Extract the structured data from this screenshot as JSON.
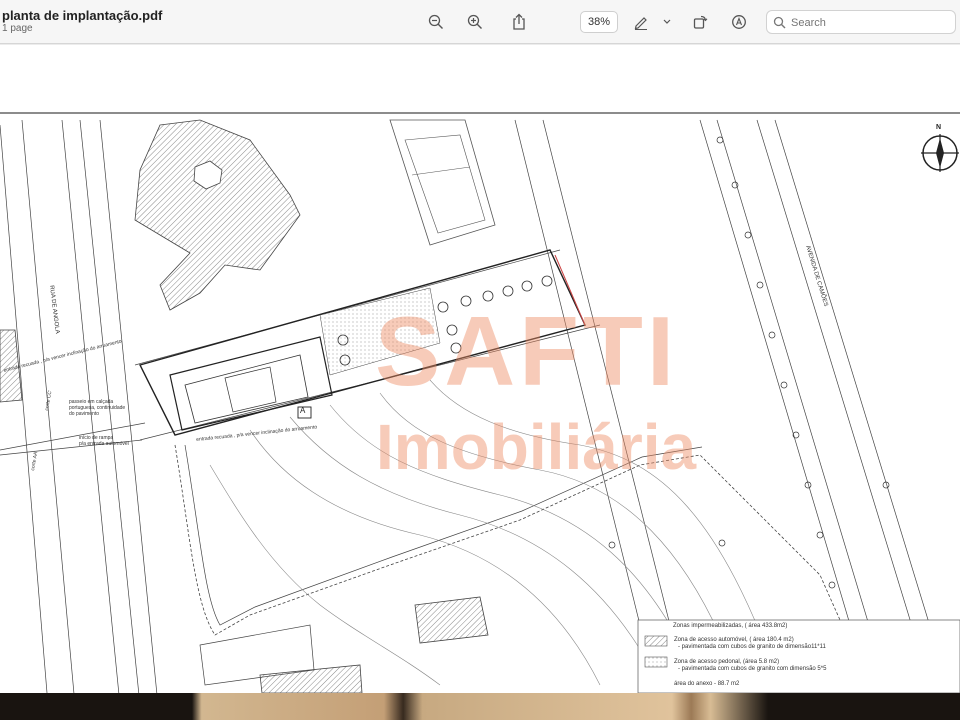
{
  "window": {
    "title": "planta de implantação.pdf",
    "subtitle": "1 page"
  },
  "toolbar": {
    "zoom": "38%",
    "search_placeholder": "Search"
  },
  "drawing": {
    "street_left": "RUA DE ANGOLA",
    "street_right": "AVENIDA DE CAMÕES",
    "compass": "N",
    "label_a": "A",
    "note_top": "entrada recuada , p/a vencer inclinação do arruamento",
    "note_left_1": "passeio em calçada",
    "note_left_2": "portuguesa, continuidade",
    "note_left_3": "do pavimento",
    "note_left_4": "início de rampa",
    "note_left_5": "p/a entrada automóvel",
    "note_bottom": "entrada recuada , p/a vencer inclinação do arruamento",
    "marker_1": "corte CC'",
    "marker_2": "corte AA'"
  },
  "watermark": {
    "brand": "SAFTI",
    "sub": "Imobiliária"
  },
  "legend": {
    "title": "Zonas impermeabilizadas, ( área 433.8m2)",
    "item1_a": "Zona de acesso automóvel, ( área 180.4 m2)",
    "item1_b": "- pavimentada com cubos de granito de dimensão11*11",
    "item2_a": "Zona de acesso pedonal, (área 5.8 m2)",
    "item2_b": "- pavimentada com cubos de granito com dimensão 5*5",
    "item3": "área do anexo - 88.7 m2"
  }
}
